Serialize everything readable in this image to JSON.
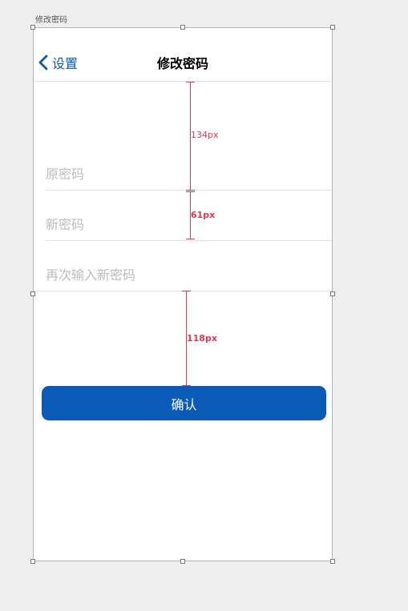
{
  "artboard": {
    "label": "修改密码"
  },
  "navbar": {
    "back_label": "设置",
    "title": "修改密码"
  },
  "form": {
    "old_password_placeholder": "原密码",
    "new_password_placeholder": "新密码",
    "confirm_password_placeholder": "再次输入新密码"
  },
  "confirm_button": {
    "label": "确认"
  },
  "annotations": {
    "measure_1": "134px",
    "measure_2": "61px",
    "measure_3": "118px"
  },
  "colors": {
    "accent": "#0a5bb8",
    "annotation": "#e8384f",
    "placeholder": "#bdbdbd",
    "canvas": "#eeeeee"
  }
}
